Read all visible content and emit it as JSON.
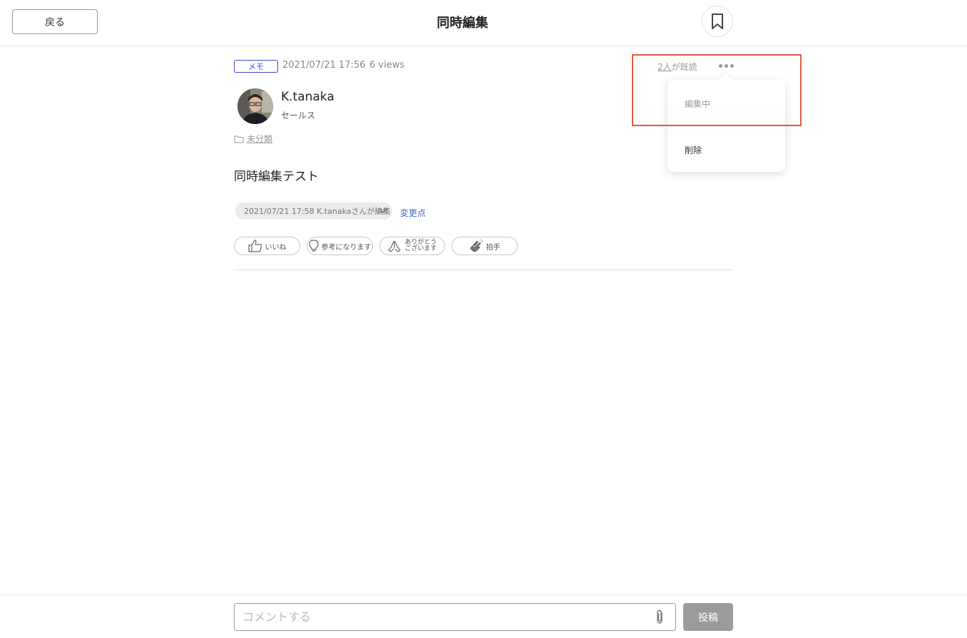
{
  "header": {
    "back_label": "戻る",
    "title": "同時編集",
    "bookmark_icon": "bookmark-icon"
  },
  "post": {
    "tag": "メモ",
    "date": "2021/07/21 17:56",
    "views": "6 views",
    "readers_count": "2人",
    "readers_suffix": "が既読",
    "author": {
      "name": "K.tanaka",
      "department": "セールス"
    },
    "folder": "未分類",
    "body": "同時編集テスト",
    "history": "2021/07/21 17:58 K.tanakaさんが編集",
    "changes_link": "変更点",
    "reactions": [
      {
        "icon": "thumbs-up-icon",
        "label": "いいね"
      },
      {
        "icon": "lightbulb-icon",
        "label": "参考になります"
      },
      {
        "icon": "pray-hands-icon",
        "label_line1": "ありがとう",
        "label_line2": "ございます"
      },
      {
        "icon": "clap-icon",
        "label": "拍手"
      }
    ]
  },
  "menu": {
    "items": [
      "編集中",
      "削除"
    ]
  },
  "footer": {
    "comment_placeholder": "コメントする",
    "post_label": "投稿"
  },
  "colors": {
    "accent": "#3f48cc",
    "link": "#4a63c8",
    "highlight": "#e05a45",
    "disabled_button": "#9b9b9b"
  }
}
